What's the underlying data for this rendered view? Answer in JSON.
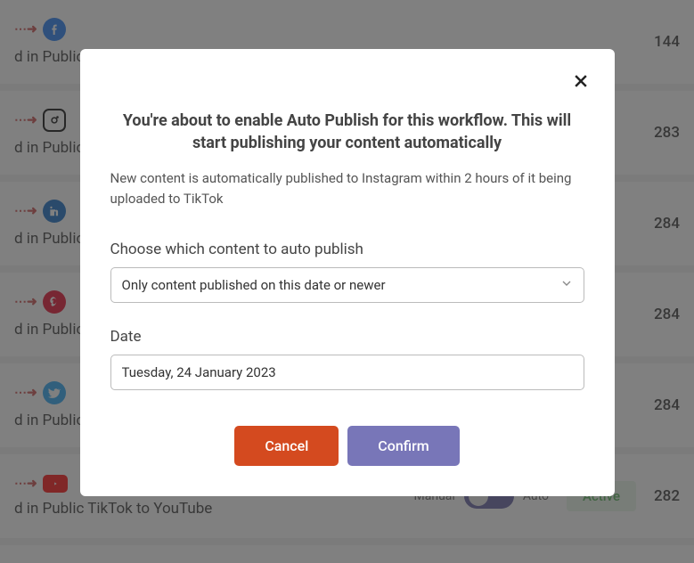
{
  "rows": [
    {
      "title": "d in Public Ti",
      "count": "144",
      "platform": "facebook"
    },
    {
      "title": "d in Public Ti",
      "count": "283",
      "platform": "instagram"
    },
    {
      "title": "d in Public Ti",
      "count": "284",
      "platform": "linkedin"
    },
    {
      "title": "d in Public Ti",
      "count": "284",
      "platform": "pinterest"
    },
    {
      "title": "d in Public Ti",
      "count": "284",
      "platform": "twitter"
    },
    {
      "title": "d in Public TikTok to YouTube",
      "count": "282",
      "platform": "youtube"
    }
  ],
  "toggle": {
    "manual_label": "Manual",
    "auto_label": "Auto",
    "active_label": "Active"
  },
  "modal": {
    "title": "You're about to enable Auto Publish for this workflow. This will start publishing your content automatically",
    "description": "New content is automatically published to Instagram within 2 hours of it being uploaded to TikTok",
    "content_label": "Choose which content to auto publish",
    "content_select_value": "Only content published on this date or newer",
    "date_label": "Date",
    "date_value": "Tuesday, 24 January 2023",
    "cancel_label": "Cancel",
    "confirm_label": "Confirm"
  }
}
